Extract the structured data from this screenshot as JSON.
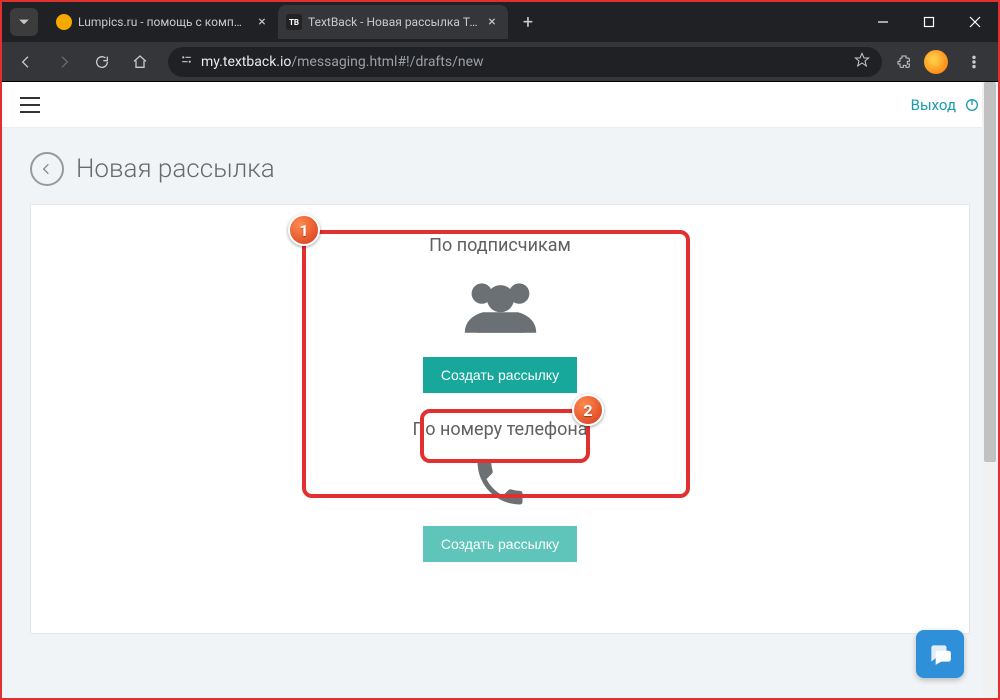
{
  "browser": {
    "tabs": [
      {
        "label": "Lumpics.ru - помощь с компью"
      },
      {
        "label": "TextBack - Новая рассылка Tex"
      }
    ],
    "url_domain": "my.textback.io",
    "url_path": "/messaging.html#!/drafts/new"
  },
  "app": {
    "logout_label": "Выход",
    "page_title": "Новая рассылка",
    "option1": {
      "title": "По подписчикам",
      "button": "Создать рассылку"
    },
    "option2": {
      "title": "По номеру телефона",
      "button": "Создать рассылку"
    }
  },
  "annotations": {
    "marker1": "1",
    "marker2": "2"
  }
}
